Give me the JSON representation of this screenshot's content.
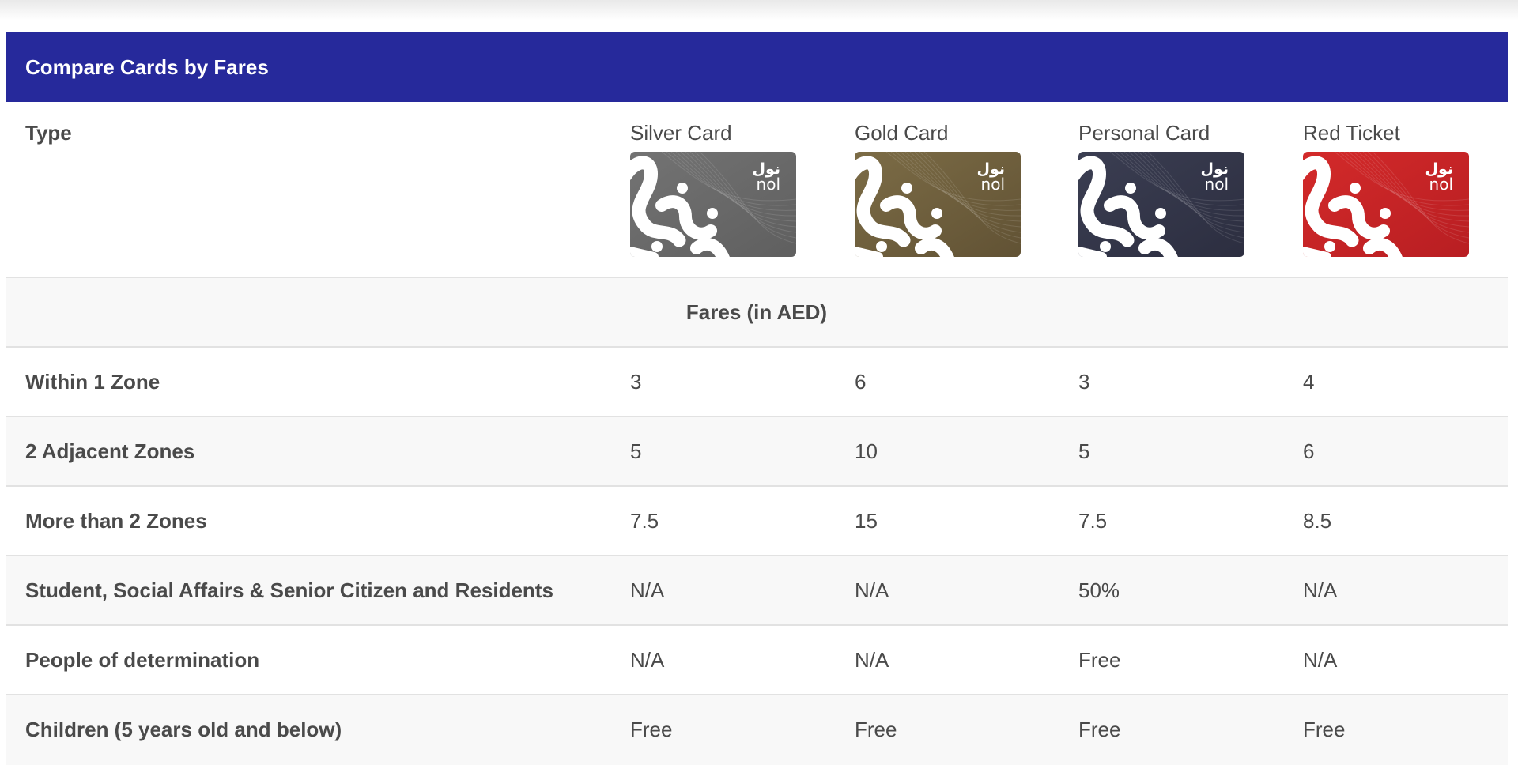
{
  "header": {
    "title": "Compare Cards by Fares"
  },
  "type_row": {
    "label": "Type"
  },
  "cards": [
    {
      "name": "Silver Card",
      "color": "#737373",
      "color_dark": "#5f5f5f",
      "logo_arabic": "نول",
      "logo_latin": "nol"
    },
    {
      "name": "Gold Card",
      "color": "#7c6c46",
      "color_dark": "#615234",
      "logo_arabic": "نول",
      "logo_latin": "nol"
    },
    {
      "name": "Personal Card",
      "color": "#3b3e52",
      "color_dark": "#2c2e40",
      "logo_arabic": "نول",
      "logo_latin": "nol"
    },
    {
      "name": "Red Ticket",
      "color": "#d32a2a",
      "color_dark": "#b81e22",
      "logo_arabic": "نول",
      "logo_latin": "nol"
    }
  ],
  "section": {
    "label": "Fares (in AED)"
  },
  "rows": [
    {
      "label": "Within 1 Zone",
      "values": [
        "3",
        "6",
        "3",
        "4"
      ]
    },
    {
      "label": "2 Adjacent Zones",
      "values": [
        "5",
        "10",
        "5",
        "6"
      ]
    },
    {
      "label": "More than 2 Zones",
      "values": [
        "7.5",
        "15",
        "7.5",
        "8.5"
      ]
    },
    {
      "label": "Student, Social Affairs & Senior Citizen and Residents",
      "values": [
        "N/A",
        "N/A",
        "50%",
        "N/A"
      ]
    },
    {
      "label": "People of determination",
      "values": [
        "N/A",
        "N/A",
        "Free",
        "N/A"
      ]
    },
    {
      "label": "Children (5 years old and below)",
      "values": [
        "Free",
        "Free",
        "Free",
        "Free"
      ]
    }
  ],
  "colors": {
    "header_bg": "#26299b",
    "header_text": "#ffffff",
    "alt_row_bg": "#f8f8f8",
    "border": "#e2e2e2"
  }
}
